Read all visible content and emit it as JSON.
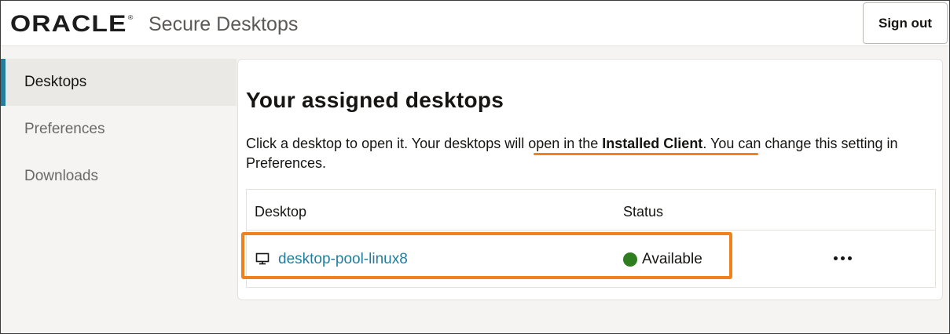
{
  "header": {
    "logo_text": "ORACLE",
    "logo_mark": "®",
    "app_title": "Secure Desktops",
    "sign_out_label": "Sign out"
  },
  "sidebar": {
    "items": [
      {
        "label": "Desktops",
        "active": true
      },
      {
        "label": "Preferences",
        "active": false
      },
      {
        "label": "Downloads",
        "active": false
      }
    ]
  },
  "main": {
    "title": "Your assigned desktops",
    "info_before": "Click a desktop to open it. Your desktops ",
    "info_highlight": "will open in the ",
    "info_bold": "Installed Client",
    "info_after": ". You can change this setting in Preferences.",
    "table": {
      "columns": [
        "Desktop",
        "Status"
      ],
      "rows": [
        {
          "desktop": "desktop-pool-linux8",
          "status": "Available",
          "icon": "monitor-icon",
          "status_icon": "status-dot-icon",
          "action_icon": "more-actions-icon"
        }
      ]
    }
  },
  "colors": {
    "accent": "#227e9e",
    "highlight": "#f0821e",
    "status_available": "#2e7d1e"
  }
}
